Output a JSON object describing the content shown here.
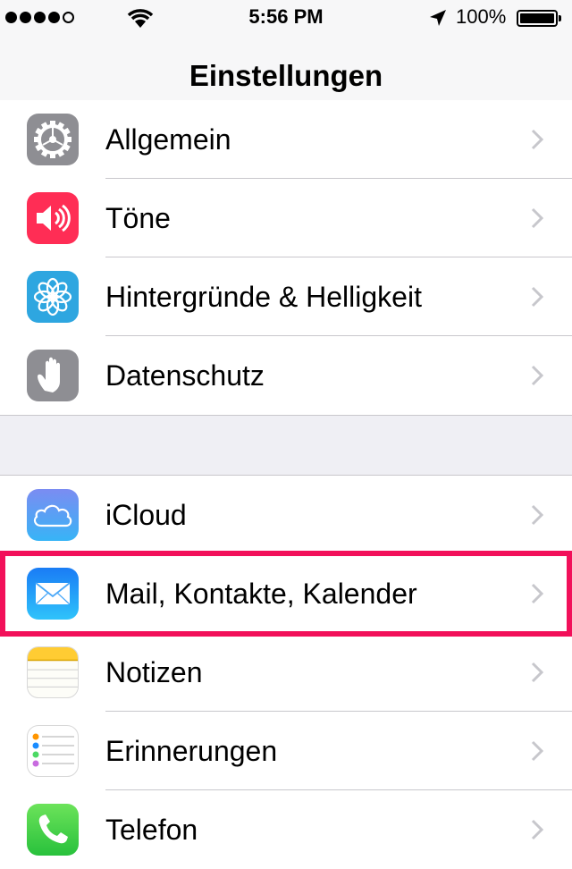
{
  "status_bar": {
    "signal_bars": 4,
    "time": "5:56 PM",
    "battery": "100%",
    "icons": [
      "cellular-signal-icon",
      "wifi-icon",
      "location-arrow-icon",
      "battery-icon"
    ]
  },
  "navigation": {
    "title": "Einstellungen"
  },
  "groups": [
    {
      "items": [
        {
          "label": "Allgemein",
          "icon": "gear-icon",
          "icon_color": "#8e8e93"
        },
        {
          "label": "Töne",
          "icon": "speaker-icon",
          "icon_color": "#ff2d55"
        },
        {
          "label": "Hintergründe & Helligkeit",
          "icon": "flower-icon",
          "icon_color": "#2ea6e0"
        },
        {
          "label": "Datenschutz",
          "icon": "hand-icon",
          "icon_color": "#8e8e93"
        }
      ]
    },
    {
      "items": [
        {
          "label": "iCloud",
          "icon": "cloud-icon",
          "icon_color": "#5b8ff9"
        },
        {
          "label": "Mail, Kontakte, Kalender",
          "icon": "envelope-icon",
          "icon_color": "#1a8cff",
          "highlighted": true
        },
        {
          "label": "Notizen",
          "icon": "notes-icon",
          "icon_color": "#ffd33c"
        },
        {
          "label": "Erinnerungen",
          "icon": "reminders-icon",
          "icon_color": "#ffffff"
        },
        {
          "label": "Telefon",
          "icon": "phone-icon",
          "icon_color": "#4cd964"
        }
      ]
    }
  ],
  "highlight_color": "#f2105a"
}
